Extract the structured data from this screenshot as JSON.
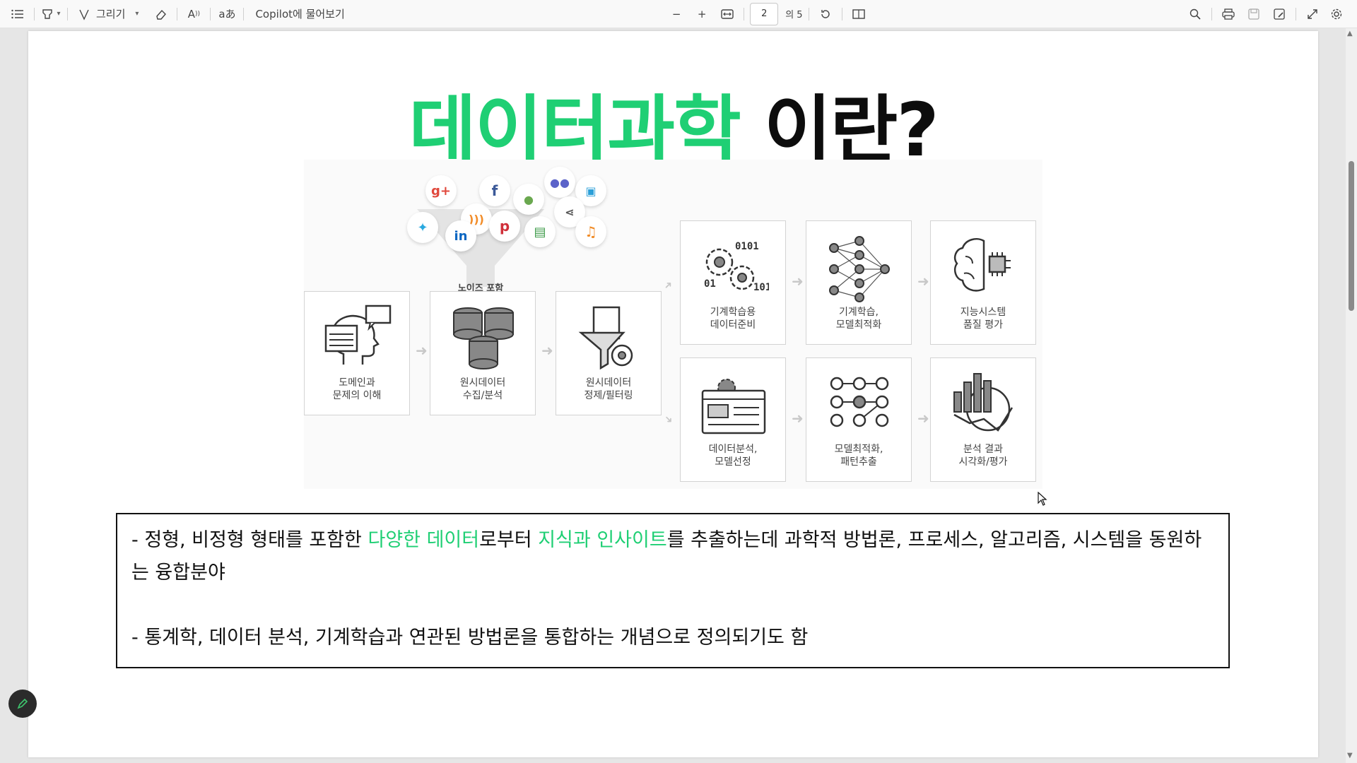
{
  "toolbar": {
    "draw_label": "그리기",
    "read_aloud_label": "A",
    "translate_label": "aあ",
    "copilot_label": "Copilot에 물어보기",
    "zoom_out": "−",
    "zoom_in": "+",
    "page_current": "2",
    "page_of": "의 5"
  },
  "slide": {
    "title_highlight": "데이터과학",
    "title_rest": " 이란?",
    "diagram": {
      "funnel_label": "노이즈 포함\n원시 데이터",
      "boxes": [
        {
          "label": "도메인과\n문제의 이해"
        },
        {
          "label": "원시데이터\n수집/분석"
        },
        {
          "label": "원시데이터\n정제/필터링"
        },
        {
          "label": "기계학습용\n데이터준비"
        },
        {
          "label": "기계학습,\n모델최적화"
        },
        {
          "label": "지능시스템\n품질 평가"
        },
        {
          "label": "데이터분석,\n모델선정"
        },
        {
          "label": "모델최적화,\n패턴추출"
        },
        {
          "label": "분석 결과\n시각화/평가"
        }
      ],
      "social_icons": [
        "g+",
        "f",
        "mic",
        "group",
        "image",
        "rss",
        "pinterest",
        "share",
        "twitter",
        "in",
        "document",
        "music"
      ],
      "social_labels": {
        "gplus": "g+",
        "facebook": "f",
        "pinterest": "p",
        "linkedin": "in",
        "music": "♫"
      }
    },
    "text": {
      "p1_a": "- 정형, 비정형 형태를 포함한 ",
      "p1_g1": "다양한 데이터",
      "p1_b": "로부터 ",
      "p1_g2": "지식과 인사이트",
      "p1_c": "를 추출하는데 과학적 방법론, 프로세스, 알고리즘, 시스템을 동원하는 융합분야",
      "p2": "- 통계학, 데이터 분석, 기계학습과 연관된 방법론을 통합하는 개념으로 정의되기도 함"
    }
  },
  "colors": {
    "accent_green": "#1fcf74",
    "title_black": "#0d0d0d"
  }
}
